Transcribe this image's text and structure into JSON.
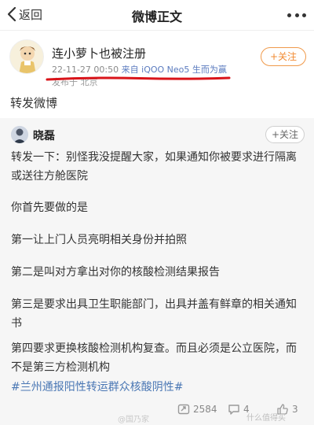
{
  "nav": {
    "back_label": "返回",
    "title": "微博正文"
  },
  "post": {
    "author": "连小萝卜也被注册",
    "timestamp": "22-11-27 00:50",
    "source": "来自 iQOO Neo5 生而为赢",
    "published_from": "发布于 北京",
    "follow_label": "+关注",
    "text": "转发微博"
  },
  "quoted": {
    "author": "晓磊",
    "follow_label": "+关注",
    "paragraphs": [
      "转发一下：别怪我没提醒大家，如果通知你被要求进行隔离或送往方舱医院",
      "你首先要做的是",
      "第一让上门人员亮明相关身份并拍照",
      "第二是叫对方拿出对你的核酸检测结果报告",
      "第三是要求出具卫生职能部门，出具并盖有鲜章的相关通知书",
      "第四要求更换核酸检测机构复查。而且必须是公立医院，而不是第三方检测机构"
    ],
    "topic": "#兰州通报阳性转运群众核酸阴性#"
  },
  "stats": {
    "reposts": "2584",
    "comments": "4",
    "likes": "3"
  },
  "watermark": {
    "left": "@国乃家",
    "right": "什么值得买"
  },
  "colors": {
    "accent_orange": "#f28a32",
    "link_blue": "#4a77b4",
    "annotation_red": "#d9141a"
  }
}
